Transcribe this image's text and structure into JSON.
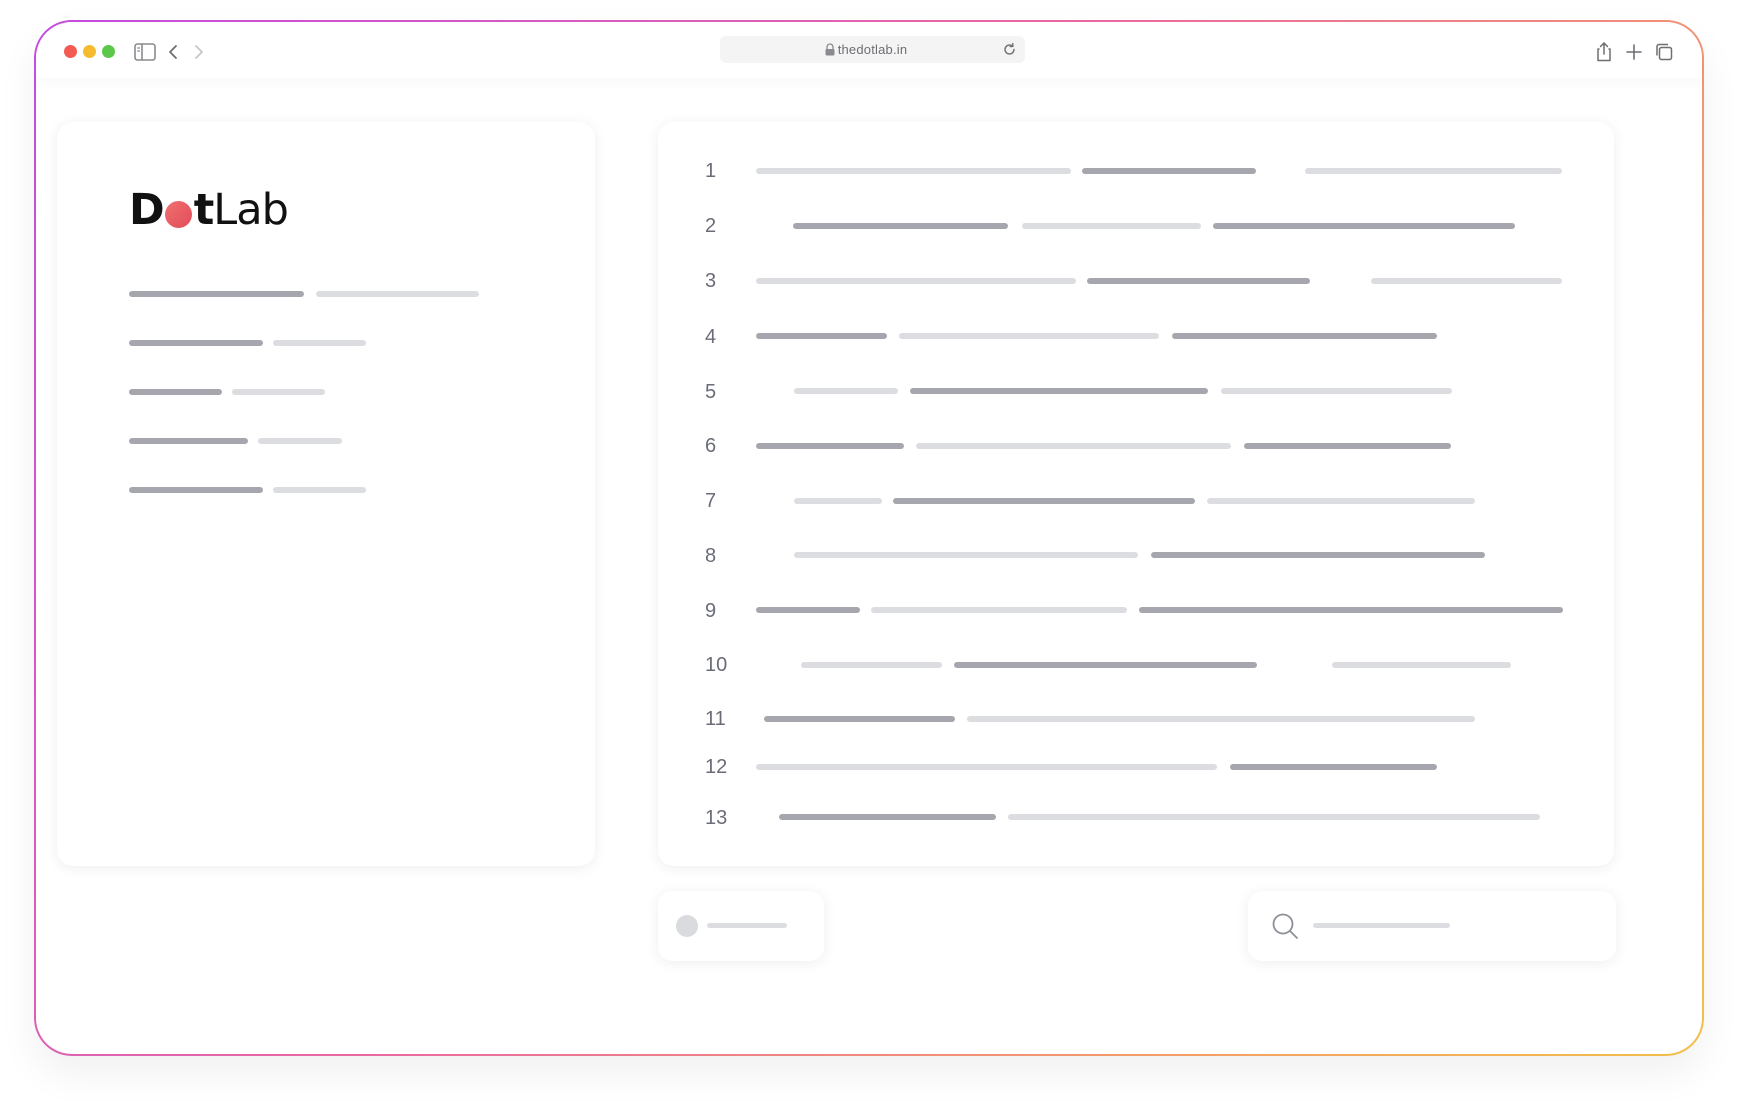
{
  "browser": {
    "url": "thedotlab.in",
    "icons": [
      "sidebar-toggle-icon",
      "back-icon",
      "forward-icon",
      "lock-icon",
      "reload-icon",
      "share-icon",
      "new-tab-icon",
      "tabs-overview-icon"
    ]
  },
  "logo": {
    "part1": "D",
    "part2": "t",
    "part3": "Lab",
    "dot_color": "#e24d5a"
  },
  "editor": {
    "line_numbers": [
      "1",
      "2",
      "3",
      "4",
      "5",
      "6",
      "7",
      "8",
      "9",
      "10",
      "11",
      "12",
      "13"
    ]
  },
  "colors": {
    "gradient_start": "#c44be0",
    "gradient_end": "#f2bf4a",
    "skeleton_dark": "#a6a7ae",
    "skeleton_light": "#dcdde1"
  }
}
